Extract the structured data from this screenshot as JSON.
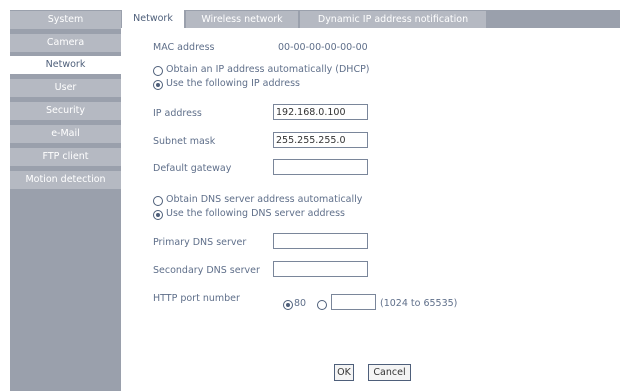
{
  "sidebar": {
    "items": [
      {
        "label": "System"
      },
      {
        "label": "Camera"
      },
      {
        "label": "Network",
        "active": true
      },
      {
        "label": "User"
      },
      {
        "label": "Security"
      },
      {
        "label": "e-Mail"
      },
      {
        "label": "FTP client"
      },
      {
        "label": "Motion detection"
      }
    ]
  },
  "tabs": [
    {
      "label": "Network",
      "active": true
    },
    {
      "label": "Wireless network"
    },
    {
      "label": "Dynamic IP address notification"
    }
  ],
  "network": {
    "mac_label": "MAC address",
    "mac_value": "00-00-00-00-00-00",
    "ip_mode": {
      "dhcp_label": "Obtain an IP address automatically (DHCP)",
      "static_label": "Use the following IP address",
      "selected": "static"
    },
    "ip_address": {
      "label": "IP address",
      "value": "192.168.0.100"
    },
    "subnet_mask": {
      "label": "Subnet mask",
      "value": "255.255.255.0"
    },
    "default_gateway": {
      "label": "Default gateway",
      "value": ""
    },
    "dns_mode": {
      "auto_label": "Obtain DNS server address automatically",
      "manual_label": "Use the following DNS server address",
      "selected": "manual"
    },
    "primary_dns": {
      "label": "Primary DNS server",
      "value": ""
    },
    "secondary_dns": {
      "label": "Secondary DNS server",
      "value": ""
    },
    "http_port": {
      "label": "HTTP port number",
      "option_default": "80",
      "custom_value": "",
      "range_hint": "(1024 to 65535)",
      "selected": "80"
    }
  },
  "buttons": {
    "ok": "OK",
    "cancel": "Cancel"
  },
  "colors": {
    "sidebar_bg": "#9aa0ac",
    "nav_inactive": "#b5b9c2",
    "nav_active": "#ffffff",
    "text": "#5f6f8a"
  }
}
